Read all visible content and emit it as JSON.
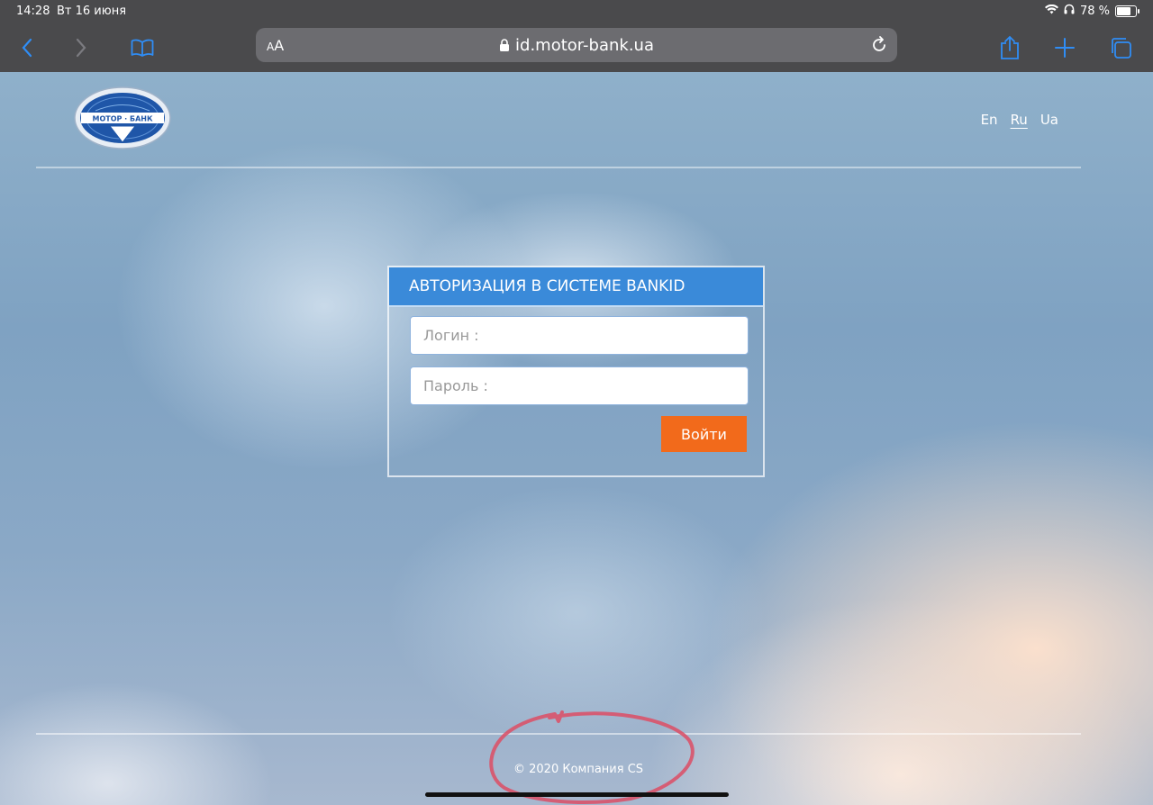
{
  "status": {
    "time": "14:28",
    "date": "Вт 16 июня",
    "battery": "78 %"
  },
  "browser": {
    "text_size_label": "AA",
    "url": "id.motor-bank.ua"
  },
  "logo": {
    "text": "МОТОР · БАНК"
  },
  "languages": [
    "En",
    "Ru",
    "Ua"
  ],
  "auth": {
    "title": "АВТОРИЗАЦИЯ В СИСТЕМЕ BANKID",
    "login_placeholder": "Логин :",
    "password_placeholder": "Пароль :",
    "submit_label": "Войти"
  },
  "footer": {
    "copyright": "© 2020 Компания CS"
  },
  "colors": {
    "header_blue": "#3a8ad9",
    "button_orange": "#f26a1b",
    "annotation_red": "#d9536a"
  }
}
